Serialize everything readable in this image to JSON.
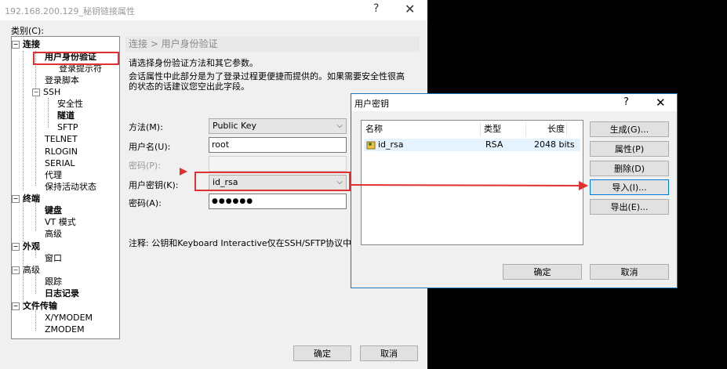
{
  "window": {
    "title": "192.168.200.129_秘钥链接属性",
    "help": "?",
    "close": "✕"
  },
  "category_label": "类别(C):",
  "tree": {
    "connect": "连接",
    "auth": "用户身份验证",
    "login_prompt": "登录提示符",
    "login_script": "登录脚本",
    "ssh": "SSH",
    "security": "安全性",
    "tunnel": "隧道",
    "sftp": "SFTP",
    "telnet": "TELNET",
    "rlogin": "RLOGIN",
    "serial": "SERIAL",
    "proxy": "代理",
    "keepalive": "保持活动状态",
    "terminal": "终端",
    "keyboard": "键盘",
    "vt": "VT 模式",
    "advanced": "高级",
    "appearance": "外观",
    "window": "窗口",
    "advanced2": "高级",
    "trace": "跟踪",
    "logging": "日志记录",
    "file_transfer": "文件传输",
    "xymodem": "X/YMODEM",
    "zmodem": "ZMODEM"
  },
  "main": {
    "breadcrumb": "连接 > 用户身份验证",
    "desc1": "请选择身份验证方法和其它参数。",
    "desc2": "会话属性中此部分是为了登录过程更便捷而提供的。如果需要安全性很高",
    "desc3": "的状态的话建议您空出此字段。",
    "method_label": "方法(M):",
    "method_value": "Public Key",
    "username_label": "用户名(U):",
    "username_value": "root",
    "password_label": "密码(P):",
    "userkey_label": "用户密钥(K):",
    "userkey_value": "id_rsa",
    "passphrase_label": "密码(A):",
    "passphrase_value": "●●●●●●",
    "note": "注释: 公钥和Keyboard Interactive仅在SSH/SFTP协议中可用",
    "ok": "确定",
    "cancel": "取消"
  },
  "dialog": {
    "title": "用户密钥",
    "help": "?",
    "close": "✕",
    "columns": [
      "名称",
      "类型",
      "长度"
    ],
    "rows": [
      {
        "name": "id_rsa",
        "type": "RSA",
        "length": "2048 bits"
      }
    ],
    "generate": "生成(G)...",
    "properties": "属性(P)",
    "delete": "删除(D)",
    "import": "导入(I)...",
    "export": "导出(E)...",
    "ok": "确定",
    "cancel": "取消"
  },
  "colors": {
    "highlight": "#e03030",
    "accent": "#1e73be"
  }
}
